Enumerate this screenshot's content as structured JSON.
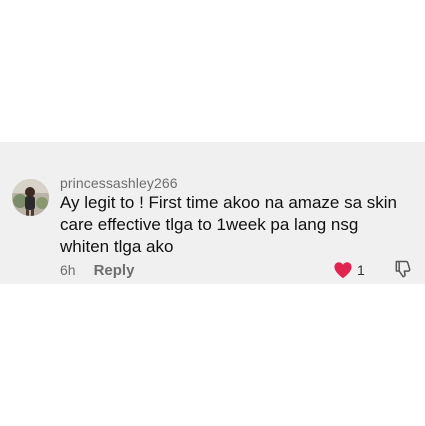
{
  "comment": {
    "username": "princessashley266",
    "text": "Ay legit to ! First time akoo na amaze sa skin\ncare effective tlga to 1week pa lang nsg\nwhiten tlga ako",
    "timestamp": "6h",
    "reply_label": "Reply",
    "like_count": "1",
    "liked": true
  },
  "icons": {
    "like": "heart-icon",
    "dislike": "thumbs-down-icon",
    "avatar": "user-avatar"
  },
  "colors": {
    "card_background": "#f0f0f0",
    "heart_fill": "#e0244f",
    "secondary_text": "#6e6e6e",
    "primary_text": "#111111"
  }
}
